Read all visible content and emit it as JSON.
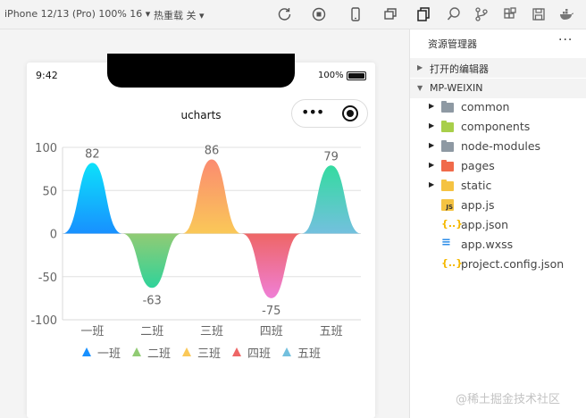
{
  "toolbar": {
    "device_label": "iPhone 12/13 (Pro) 100% 16 ▾",
    "hot_reload_label": "热重载 关 ▾",
    "icons": [
      "refresh-icon",
      "stop-icon",
      "phone-icon",
      "windows-icon",
      "files-icon",
      "search-icon",
      "branch-icon",
      "extensions-icon",
      "save-icon",
      "docker-icon"
    ]
  },
  "phone": {
    "time": "9:42",
    "battery_text": "100%",
    "nav_title": "ucharts",
    "capsule_dots": "•••"
  },
  "chart_data": {
    "type": "area",
    "categories": [
      "一班",
      "二班",
      "三班",
      "四班",
      "五班"
    ],
    "values": [
      82,
      -63,
      86,
      -75,
      79
    ],
    "data_labels": [
      "82",
      "-63",
      "86",
      "-75",
      "79"
    ],
    "ylim": [
      -100,
      100
    ],
    "yticks": [
      "100",
      "50",
      "0",
      "-50",
      "-100"
    ],
    "grid": true,
    "legend_placement": "bottom",
    "colors": [
      [
        "#0de1fa",
        "#1890ff"
      ],
      [
        "#91cb74",
        "#2fd39a"
      ],
      [
        "#fb8b70",
        "#fac858"
      ],
      [
        "#ee6666",
        "#ef7fd6"
      ],
      [
        "#34dba0",
        "#73c0de"
      ]
    ],
    "legend": [
      {
        "name": "一班",
        "color": "#1890ff"
      },
      {
        "name": "二班",
        "color": "#91cb74"
      },
      {
        "name": "三班",
        "color": "#fac858"
      },
      {
        "name": "四班",
        "color": "#ee6666"
      },
      {
        "name": "五班",
        "color": "#73c0de"
      }
    ]
  },
  "explorer": {
    "title": "资源管理器",
    "more": "···",
    "open_editors": "打开的编辑器",
    "project": "MP-WEIXIN",
    "items": [
      {
        "name": "common",
        "type": "folder",
        "color": "#8e99a3"
      },
      {
        "name": "components",
        "type": "folder",
        "color": "#a8cf4a"
      },
      {
        "name": "node-modules",
        "type": "folder",
        "color": "#8e99a3"
      },
      {
        "name": "pages",
        "type": "folder",
        "color": "#f06a4a"
      },
      {
        "name": "static",
        "type": "folder",
        "color": "#f5c342"
      },
      {
        "name": "app.js",
        "type": "js",
        "color": "#f5c342"
      },
      {
        "name": "app.json",
        "type": "json",
        "color": "#f5b800"
      },
      {
        "name": "app.wxss",
        "type": "wxss",
        "color": "#2d8ee8"
      },
      {
        "name": "project.config.json",
        "type": "json",
        "color": "#f5b800"
      }
    ]
  },
  "watermark": "@稀土掘金技术社区"
}
